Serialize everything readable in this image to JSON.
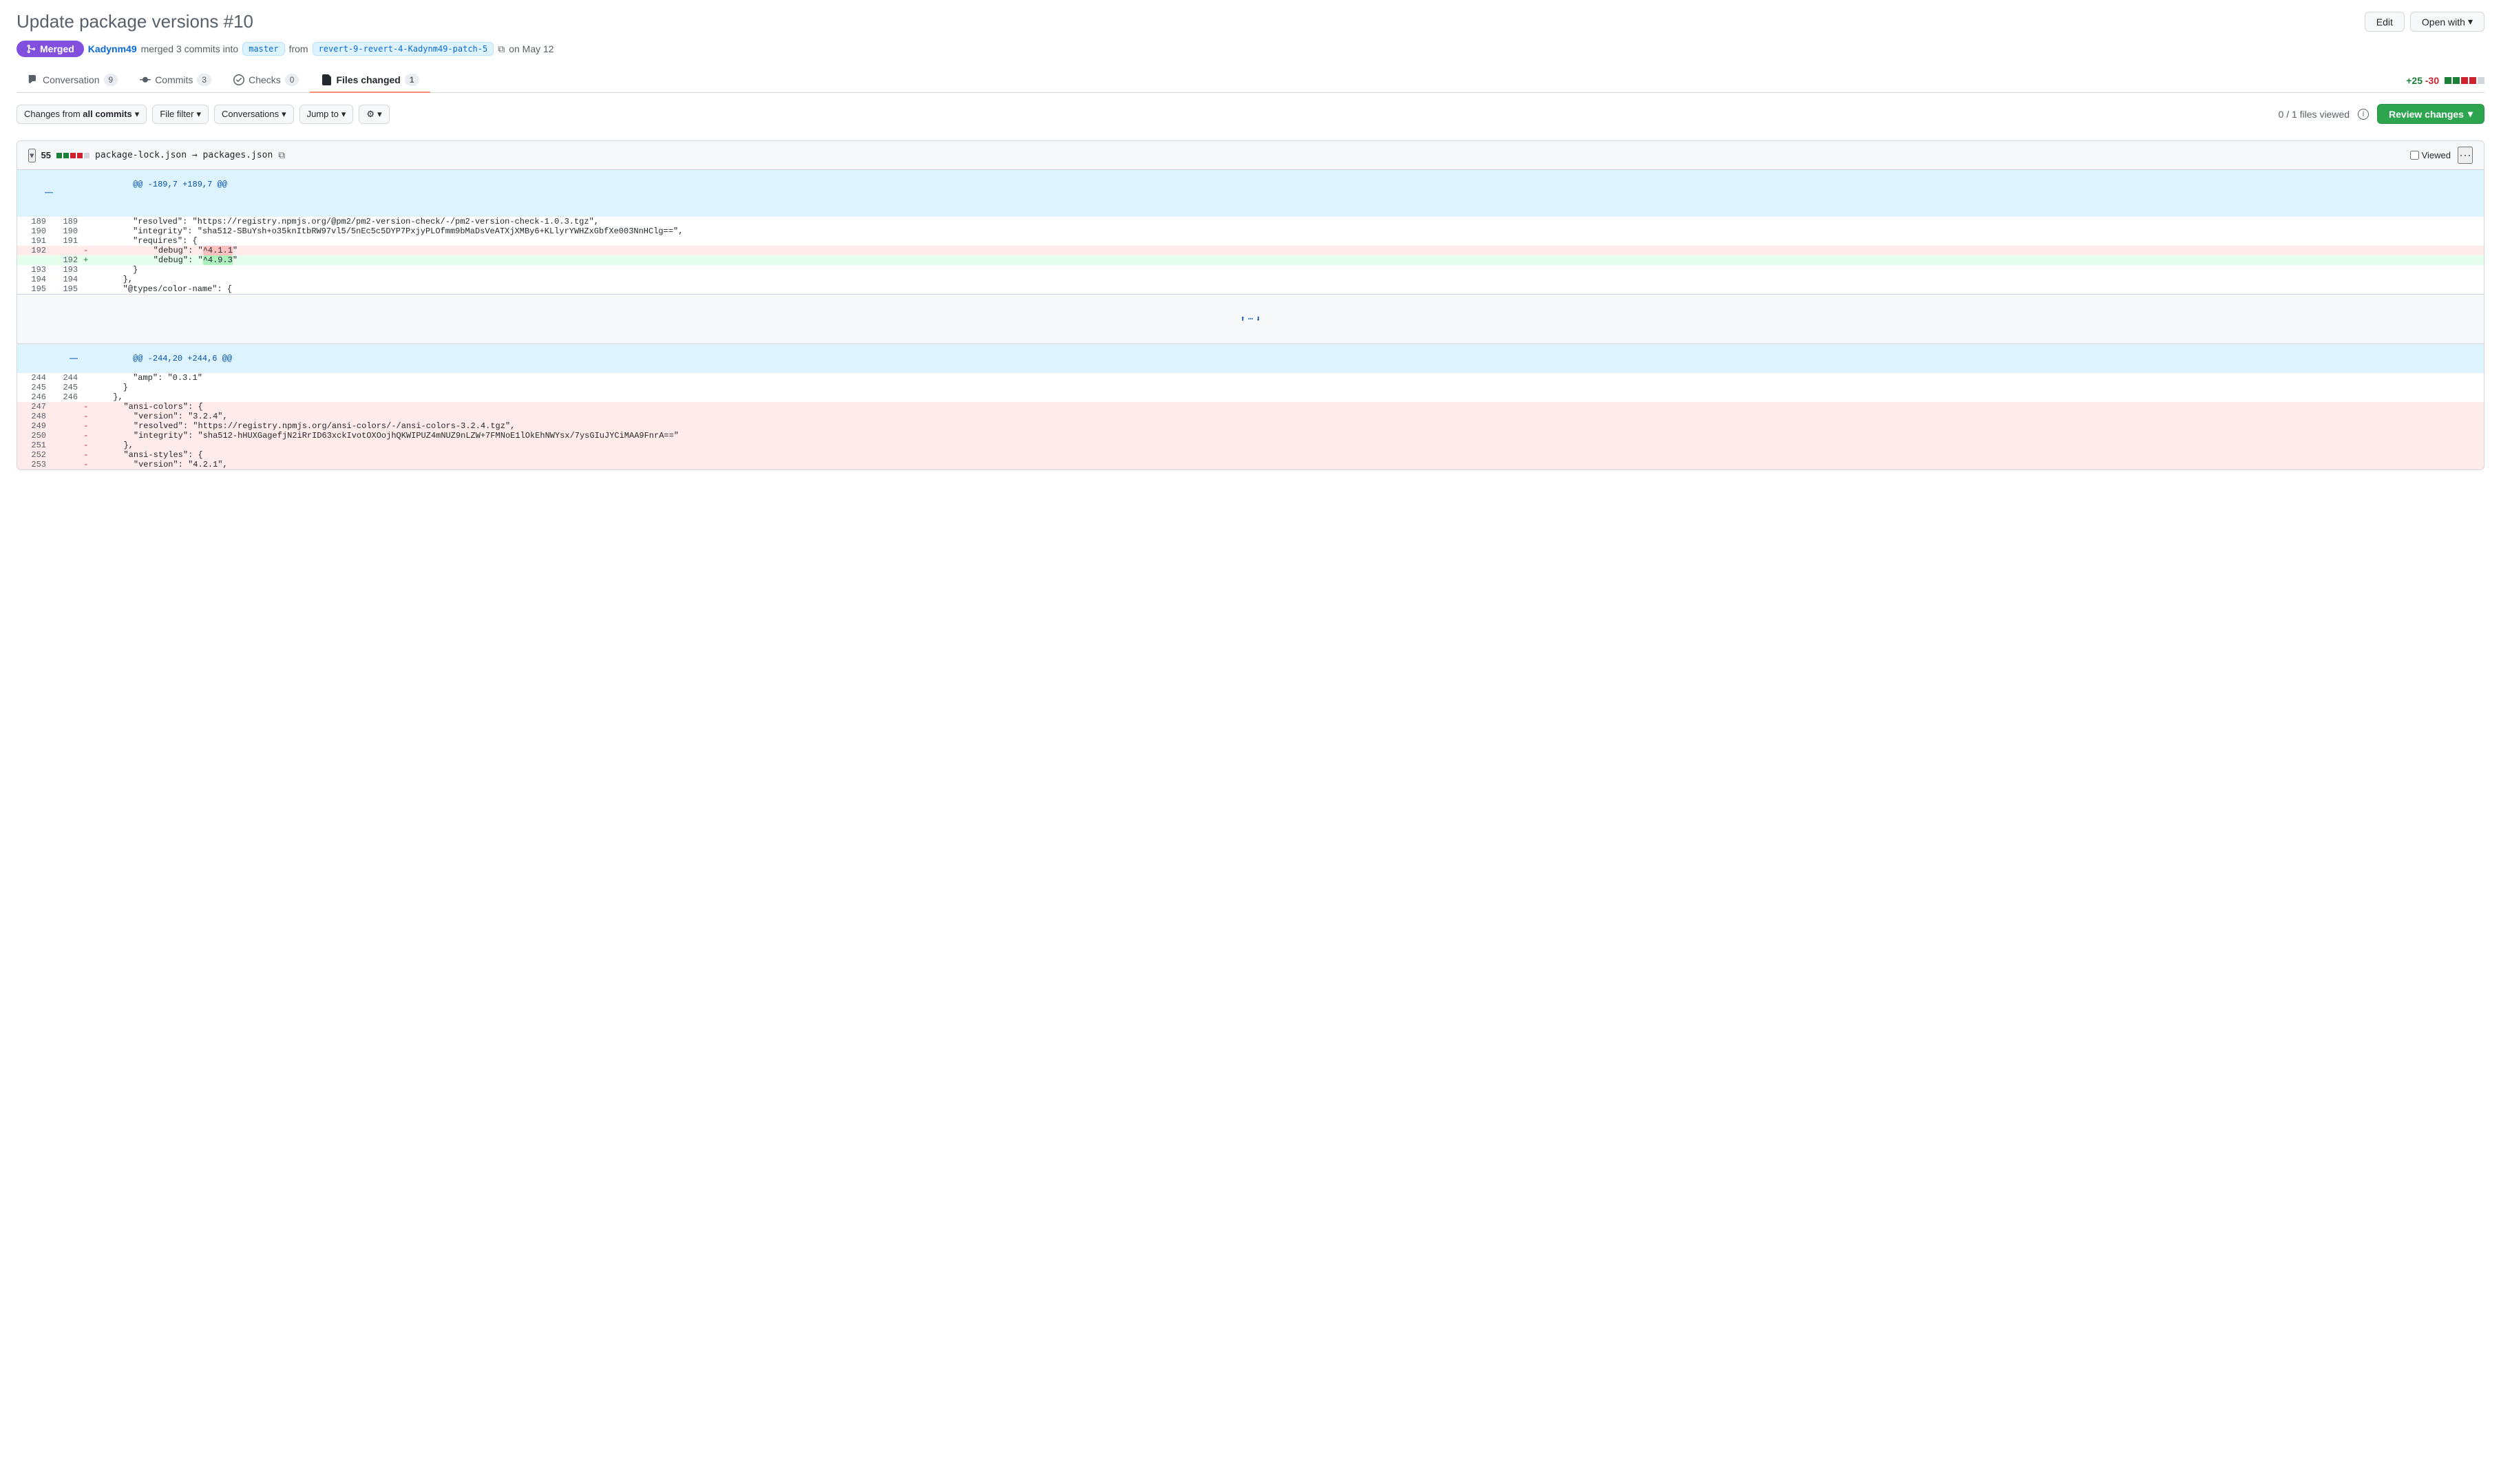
{
  "page": {
    "title": "Update package versions",
    "pr_number": "#10",
    "buttons": {
      "edit": "Edit",
      "open_with": "Open with"
    }
  },
  "pr_meta": {
    "badge": "Merged",
    "user": "Kadynm49",
    "action": "merged 3 commits into",
    "base_branch": "master",
    "from": "from",
    "head_branch": "revert-9-revert-4-Kadynm49-patch-5",
    "date_label": "on May 12"
  },
  "tabs": {
    "conversation": {
      "label": "Conversation",
      "count": "9"
    },
    "commits": {
      "label": "Commits",
      "count": "3"
    },
    "checks": {
      "label": "Checks",
      "count": "0"
    },
    "files_changed": {
      "label": "Files changed",
      "count": "1"
    },
    "diff_stat": {
      "additions": "+25",
      "deletions": "-30"
    }
  },
  "toolbar": {
    "changes_from": "Changes from",
    "all_commits": "all commits",
    "file_filter": "File filter",
    "conversations": "Conversations",
    "jump_to": "Jump to",
    "files_viewed": "0 / 1 files viewed",
    "review_changes": "Review changes"
  },
  "diff_file": {
    "stats": {
      "count": "55",
      "additions": "+",
      "deletions": "-"
    },
    "filename_from": "package-lock.json",
    "arrow": "→",
    "filename_to": "packages.json",
    "viewed_label": "Viewed"
  },
  "diff_lines": {
    "hunk1": {
      "header": "@@ -189,7 +189,7 @@"
    },
    "hunk2": {
      "header": "@@ -244,20 +244,6 @@"
    },
    "lines": [
      {
        "type": "normal",
        "old": "189",
        "new": "189",
        "content": "          \"resolved\": \"https://registry.npmjs.org/@pm2/pm2-version-check/-/pm2-version-check-1.0.3.tgz\","
      },
      {
        "type": "normal",
        "old": "190",
        "new": "190",
        "content": "          \"integrity\": \"sha512-SBuYsh+o35knItbRW97vl5/5nEc5c5DYP7PxjyPLOfmm9bMaDsVeATXjXMBy6+KLlyrYWHZxGbfXe003NnHClg==\","
      },
      {
        "type": "normal",
        "old": "191",
        "new": "191",
        "content": "          \"requires\": {"
      },
      {
        "type": "removed",
        "old": "192",
        "new": "",
        "content": "            \"debug\": \"^4.1.1\"",
        "highlight_start": 23,
        "highlight_end": 28
      },
      {
        "type": "added",
        "old": "",
        "new": "192",
        "content": "            \"debug\": \"^4.9.3\"",
        "highlight_start": 23,
        "highlight_end": 28
      },
      {
        "type": "normal",
        "old": "193",
        "new": "193",
        "content": "          }"
      },
      {
        "type": "normal",
        "old": "194",
        "new": "194",
        "content": "        },"
      },
      {
        "type": "normal",
        "old": "195",
        "new": "195",
        "content": "        \"@types/color-name\": {"
      },
      {
        "type": "normal",
        "old": "244",
        "new": "244",
        "content": "          \"amp\": \"0.3.1\""
      },
      {
        "type": "normal",
        "old": "245",
        "new": "245",
        "content": "        }"
      },
      {
        "type": "normal",
        "old": "246",
        "new": "246",
        "content": "      },"
      },
      {
        "type": "removed",
        "old": "247",
        "new": "",
        "content": "      \"ansi-colors\": {"
      },
      {
        "type": "removed",
        "old": "248",
        "new": "",
        "content": "        \"version\": \"3.2.4\","
      },
      {
        "type": "removed",
        "old": "249",
        "new": "",
        "content": "        \"resolved\": \"https://registry.npmjs.org/ansi-colors/-/ansi-colors-3.2.4.tgz\","
      },
      {
        "type": "removed",
        "old": "250",
        "new": "",
        "content": "        \"integrity\": \"sha512-hHUXGagefjN2iRrID63xckIvotOXOojhQKWIPUZ4mNUZ9nLZW+7FMNoE1lOkEhNWYsx/7ysGIuJYCiMAA9FnrA==\""
      },
      {
        "type": "removed",
        "old": "251",
        "new": "",
        "content": "      },"
      },
      {
        "type": "removed",
        "old": "252",
        "new": "",
        "content": "      \"ansi-styles\": {"
      },
      {
        "type": "removed",
        "old": "253",
        "new": "",
        "content": "        \"version\": \"4.2.1\","
      }
    ]
  }
}
